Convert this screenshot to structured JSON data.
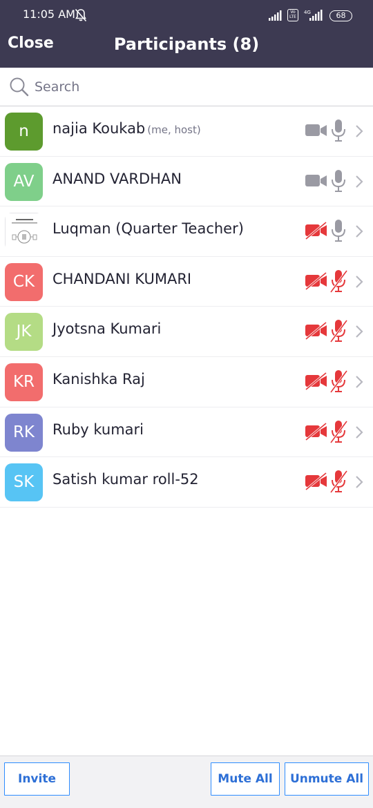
{
  "status_bar": {
    "time": "11:05 AM",
    "battery": "68",
    "volte": "Vo LTE",
    "network": "4G"
  },
  "header": {
    "close_label": "Close",
    "title": "Participants (8)"
  },
  "search": {
    "placeholder": "Search"
  },
  "colors": {
    "header_bg": "#3d3a52",
    "muted_red": "#e5383b",
    "active_gray": "#9a9aa3",
    "button_blue": "#2d8cff"
  },
  "participants": [
    {
      "initials": "n",
      "avatar_color": "#5d9b2e",
      "name": "najia Koukab",
      "tag": "(me, host)",
      "video": "on",
      "audio": "on"
    },
    {
      "initials": "AV",
      "avatar_color": "#7fcf8a",
      "name": "ANAND VARDHAN",
      "tag": "",
      "video": "on",
      "audio": "on"
    },
    {
      "initials": "",
      "avatar_color": "#ffffff",
      "name": "Luqman (Quarter Teacher)",
      "tag": "",
      "video": "off",
      "audio": "on"
    },
    {
      "initials": "CK",
      "avatar_color": "#f26d6d",
      "name": "CHANDANI KUMARI",
      "tag": "",
      "video": "off",
      "audio": "off"
    },
    {
      "initials": "JK",
      "avatar_color": "#b4dc85",
      "name": "Jyotsna Kumari",
      "tag": "",
      "video": "off",
      "audio": "off"
    },
    {
      "initials": "KR",
      "avatar_color": "#f26d6d",
      "name": "Kanishka Raj",
      "tag": "",
      "video": "off",
      "audio": "off"
    },
    {
      "initials": "RK",
      "avatar_color": "#7e85cf",
      "name": "Ruby kumari",
      "tag": "",
      "video": "off",
      "audio": "off"
    },
    {
      "initials": "SK",
      "avatar_color": "#57c4f4",
      "name": "Satish kumar roll-52",
      "tag": "",
      "video": "off",
      "audio": "off"
    }
  ],
  "footer": {
    "invite_label": "Invite",
    "mute_all_label": "Mute All",
    "unmute_all_label": "Unmute All"
  }
}
